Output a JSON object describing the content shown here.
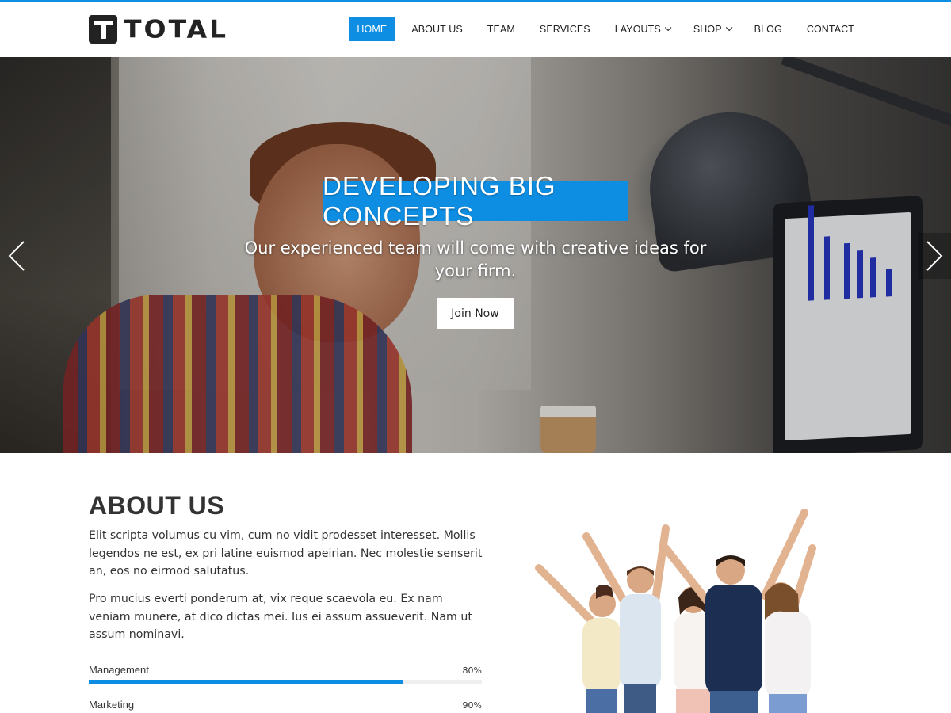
{
  "brand": {
    "name": "TOTAL",
    "accent": "#0e8ee3"
  },
  "nav": {
    "items": [
      {
        "label": "HOME",
        "active": true,
        "dropdown": false
      },
      {
        "label": "ABOUT US",
        "active": false,
        "dropdown": false
      },
      {
        "label": "TEAM",
        "active": false,
        "dropdown": false
      },
      {
        "label": "SERVICES",
        "active": false,
        "dropdown": false
      },
      {
        "label": "LAYOUTS",
        "active": false,
        "dropdown": true
      },
      {
        "label": "SHOP",
        "active": false,
        "dropdown": true
      },
      {
        "label": "BLOG",
        "active": false,
        "dropdown": false
      },
      {
        "label": "CONTACT",
        "active": false,
        "dropdown": false
      }
    ]
  },
  "hero": {
    "title": "DEVELOPING BIG CONCEPTS",
    "subtitle": "Our experienced team will come with creative ideas for your firm.",
    "button_label": "Join Now",
    "prev_icon": "chevron-left-icon",
    "next_icon": "chevron-right-icon"
  },
  "about": {
    "title": "ABOUT US",
    "paragraphs": [
      "Elit scripta volumus cu vim, cum no vidit prodesset interesset. Mollis legendos ne est, ex pri latine euismod apeirian. Nec molestie senserit an, eos no eirmod salutatus.",
      "Pro mucius everti ponderum at, vix reque scaevola eu. Ex nam veniam munere, at dico dictas mei. Ius ei assum assueverit. Nam ut assum nominavi."
    ],
    "skills": [
      {
        "label": "Management",
        "percent_text": "80%",
        "value": 0.8
      },
      {
        "label": "Marketing",
        "percent_text": "90%",
        "value": 0.9
      }
    ]
  }
}
